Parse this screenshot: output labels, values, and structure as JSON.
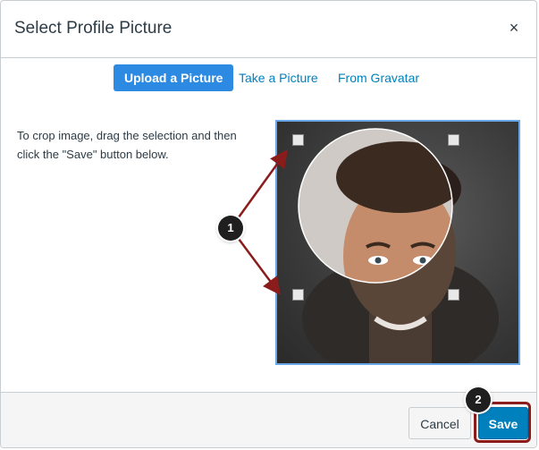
{
  "dialog": {
    "title": "Select Profile Picture",
    "close_label": "×"
  },
  "tabs": [
    {
      "label": "Upload a Picture",
      "active": true
    },
    {
      "label": "Take a Picture",
      "active": false
    },
    {
      "label": "From Gravatar",
      "active": false
    }
  ],
  "instructions": "To crop image, drag the selection and then click the \"Save\" button below.",
  "callouts": {
    "one": "1",
    "two": "2"
  },
  "footer": {
    "cancel_label": "Cancel",
    "save_label": "Save"
  },
  "colors": {
    "accent": "#0081bd",
    "active_tab": "#2d8ae2",
    "callout_arrow": "#8b1c1c",
    "crop_border": "#6aa7e9"
  },
  "icons": {
    "close": "close-icon",
    "crop_handles": "crop-handle"
  }
}
